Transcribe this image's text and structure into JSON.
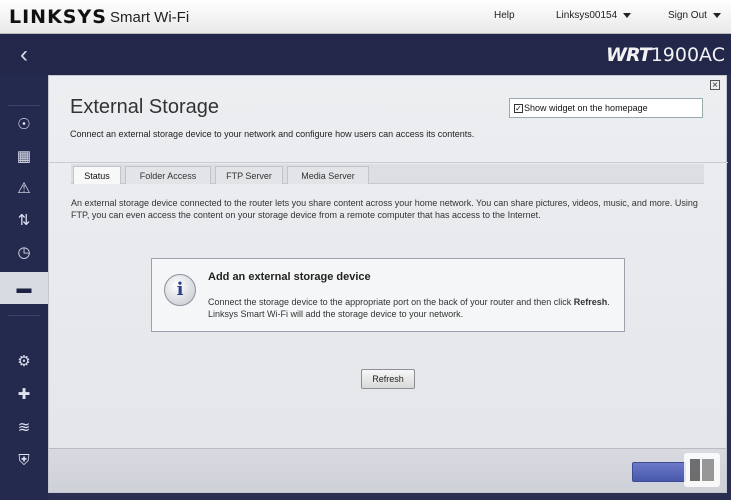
{
  "header": {
    "brand": "LINKSYS",
    "product": "Smart Wi-Fi",
    "help_label": "Help",
    "account_label": "Linksys00154",
    "signout_label": "Sign Out",
    "model_prefix": "WRT",
    "model_suffix": "1900AC"
  },
  "panel": {
    "title": "External Storage",
    "subtitle": "Connect an external storage device to your network and configure how users can access its contents.",
    "widget_checkbox": {
      "label": "Show widget on the homepage",
      "checked": true
    },
    "tabs": [
      {
        "label": "Status",
        "active": true
      },
      {
        "label": "Folder Access",
        "active": false
      },
      {
        "label": "FTP Server",
        "active": false
      },
      {
        "label": "Media Server",
        "active": false
      }
    ],
    "description": "An external storage device connected to the router lets you share content across your home network. You can share pictures, videos, music, and more. Using FTP, you can even access the content on your storage device from a remote computer that has access to the Internet.",
    "card": {
      "title": "Add an external storage device",
      "text_before": "Connect the storage device to the appropriate port on the back of your router and then click ",
      "text_bold": "Refresh",
      "text_after": ". Linksys Smart Wi-Fi will add the storage device to your network."
    },
    "refresh_label": "Refresh"
  },
  "sidebar": {
    "items": [
      {
        "icon": "network-map-icon"
      },
      {
        "icon": "calendar-icon"
      },
      {
        "icon": "warning-icon"
      },
      {
        "icon": "priority-icon"
      },
      {
        "icon": "speed-test-icon"
      },
      {
        "icon": "usb-icon",
        "active": true
      },
      {
        "icon": "gear-icon"
      },
      {
        "icon": "troubleshoot-icon"
      },
      {
        "icon": "wifi-icon"
      },
      {
        "icon": "security-icon"
      }
    ]
  }
}
